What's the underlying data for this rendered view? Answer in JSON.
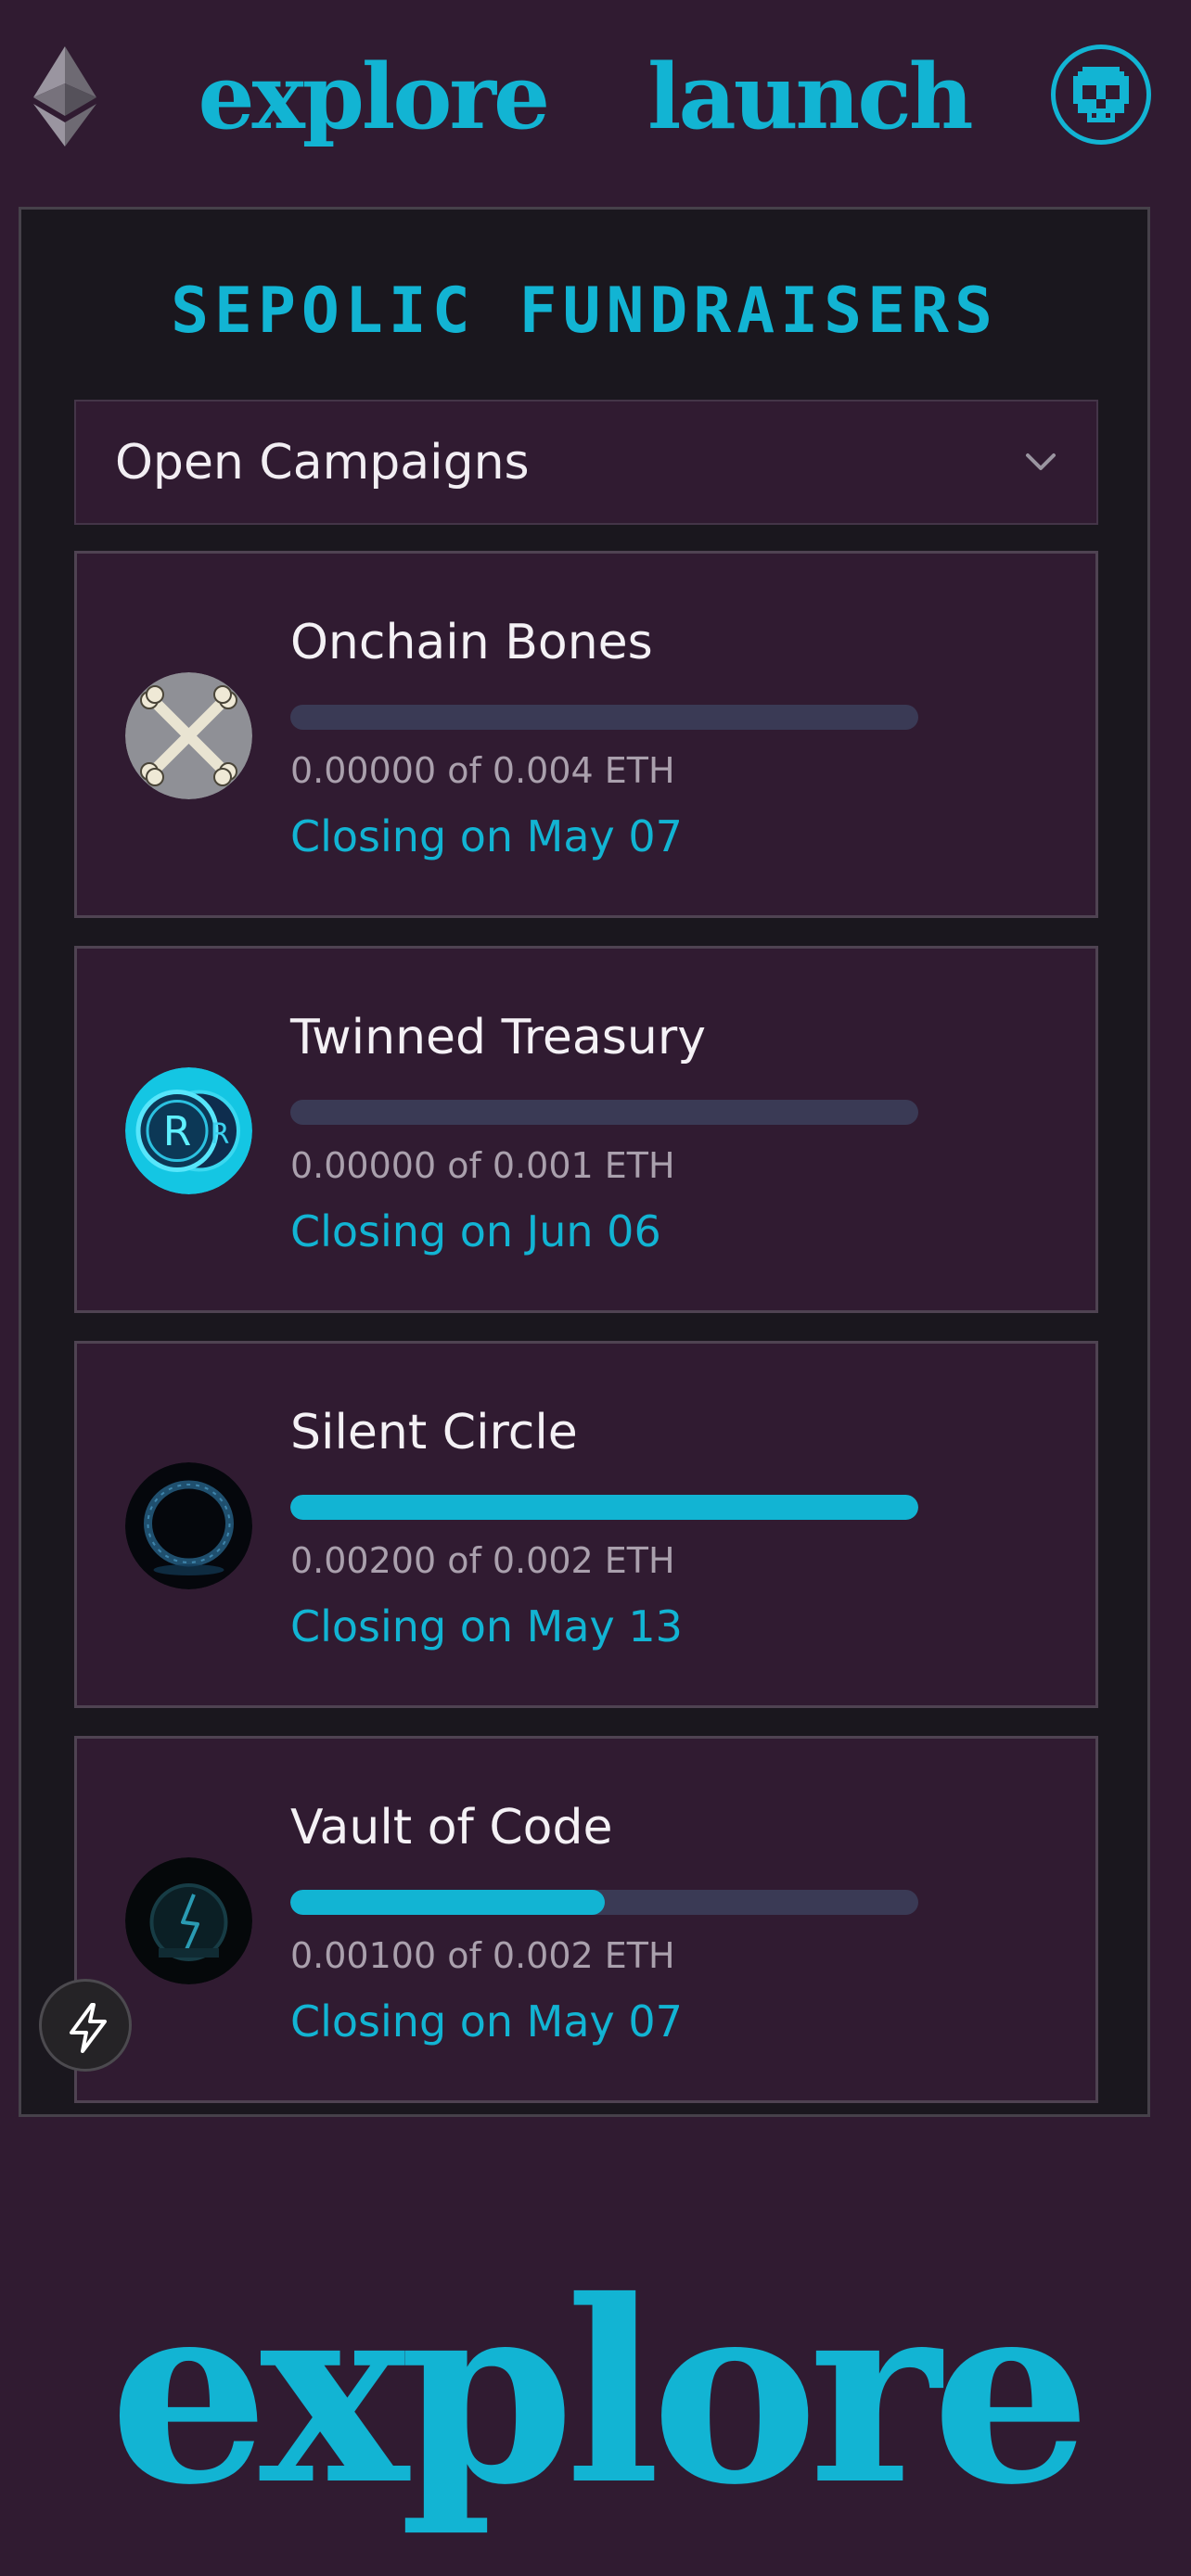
{
  "header": {
    "eth_icon": "ethereum-icon",
    "nav": {
      "explore": "explore",
      "launch": "launch"
    },
    "profile_icon": "skull-icon"
  },
  "panel": {
    "title": "SEPOLIC FUNDRAISERS",
    "dropdown": {
      "selected": "Open Campaigns",
      "icon": "chevron-down-icon"
    }
  },
  "campaigns": [
    {
      "name": "Onchain Bones",
      "raised": "0.00000",
      "goal": "0.004 ETH",
      "amount_text": "0.00000 of 0.004 ETH",
      "closing": "Closing on May 07",
      "progress": 0.0,
      "image": "crossed-bones"
    },
    {
      "name": "Twinned Treasury",
      "raised": "0.00000",
      "goal": "0.001 ETH",
      "amount_text": "0.00000 of 0.001 ETH",
      "closing": "Closing on Jun 06",
      "progress": 0.0,
      "image": "twin-coins"
    },
    {
      "name": "Silent Circle",
      "raised": "0.00200",
      "goal": "0.002 ETH",
      "amount_text": "0.00200 of 0.002 ETH",
      "closing": "Closing on May 13",
      "progress": 1.0,
      "image": "glowing-ring"
    },
    {
      "name": "Vault of Code",
      "raised": "0.00100",
      "goal": "0.002 ETH",
      "amount_text": "0.00100 of 0.002 ETH",
      "closing": "Closing on May 07",
      "progress": 0.5,
      "image": "dark-vault"
    }
  ],
  "floating_action": {
    "icon": "lightning-icon"
  },
  "footer": {
    "wordmark": "explore"
  },
  "colors": {
    "accent": "#12b4d3",
    "background": "#301b31",
    "panel": "#1a171e",
    "track": "#3a3a55"
  }
}
